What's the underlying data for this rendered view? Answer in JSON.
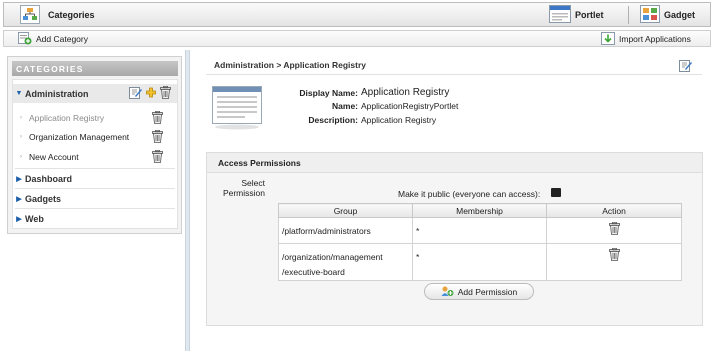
{
  "header": {
    "title": "Categories",
    "portlet_label": "Portlet",
    "gadget_label": "Gadget"
  },
  "toolbar": {
    "add_category_label": "Add Category",
    "import_label": "Import Applications"
  },
  "sidebar": {
    "heading": "CATEGORIES",
    "groups": [
      {
        "label": "Administration",
        "expanded": true,
        "items": [
          {
            "label": "Application Registry",
            "selected": true
          },
          {
            "label": "Organization Management",
            "selected": false
          },
          {
            "label": "New Account",
            "selected": false
          }
        ]
      },
      {
        "label": "Dashboard",
        "expanded": false
      },
      {
        "label": "Gadgets",
        "expanded": false
      },
      {
        "label": "Web",
        "expanded": false
      }
    ]
  },
  "main": {
    "breadcrumb": "Administration > Application Registry",
    "details": {
      "display_name_label": "Display Name:",
      "display_name": "Application Registry",
      "name_label": "Name:",
      "name": "ApplicationRegistryPortlet",
      "description_label": "Description:",
      "description": "Application Registry"
    },
    "permissions": {
      "title": "Access Permissions",
      "select_label": "Select Permission",
      "make_public_label": "Make it public (everyone can access):",
      "make_public": false,
      "columns": [
        "Group",
        "Membership",
        "Action"
      ],
      "rows": [
        {
          "group_line1": "/platform/administrators",
          "group_line2": "",
          "membership": "*"
        },
        {
          "group_line1": "/organization/management",
          "group_line2": "/executive-board",
          "membership": "*"
        }
      ],
      "add_button_label": "Add Permission"
    }
  },
  "colors": {
    "accent": "#1a5fa8",
    "sidebar_heading": "#b3b3b3",
    "divider": "#dfe7ef"
  },
  "icons": [
    "app-logo-icon",
    "portlet-icon",
    "gadget-icon",
    "add-category-icon",
    "import-icon",
    "edit-icon",
    "add-icon",
    "trash-icon",
    "add-permission-icon"
  ]
}
